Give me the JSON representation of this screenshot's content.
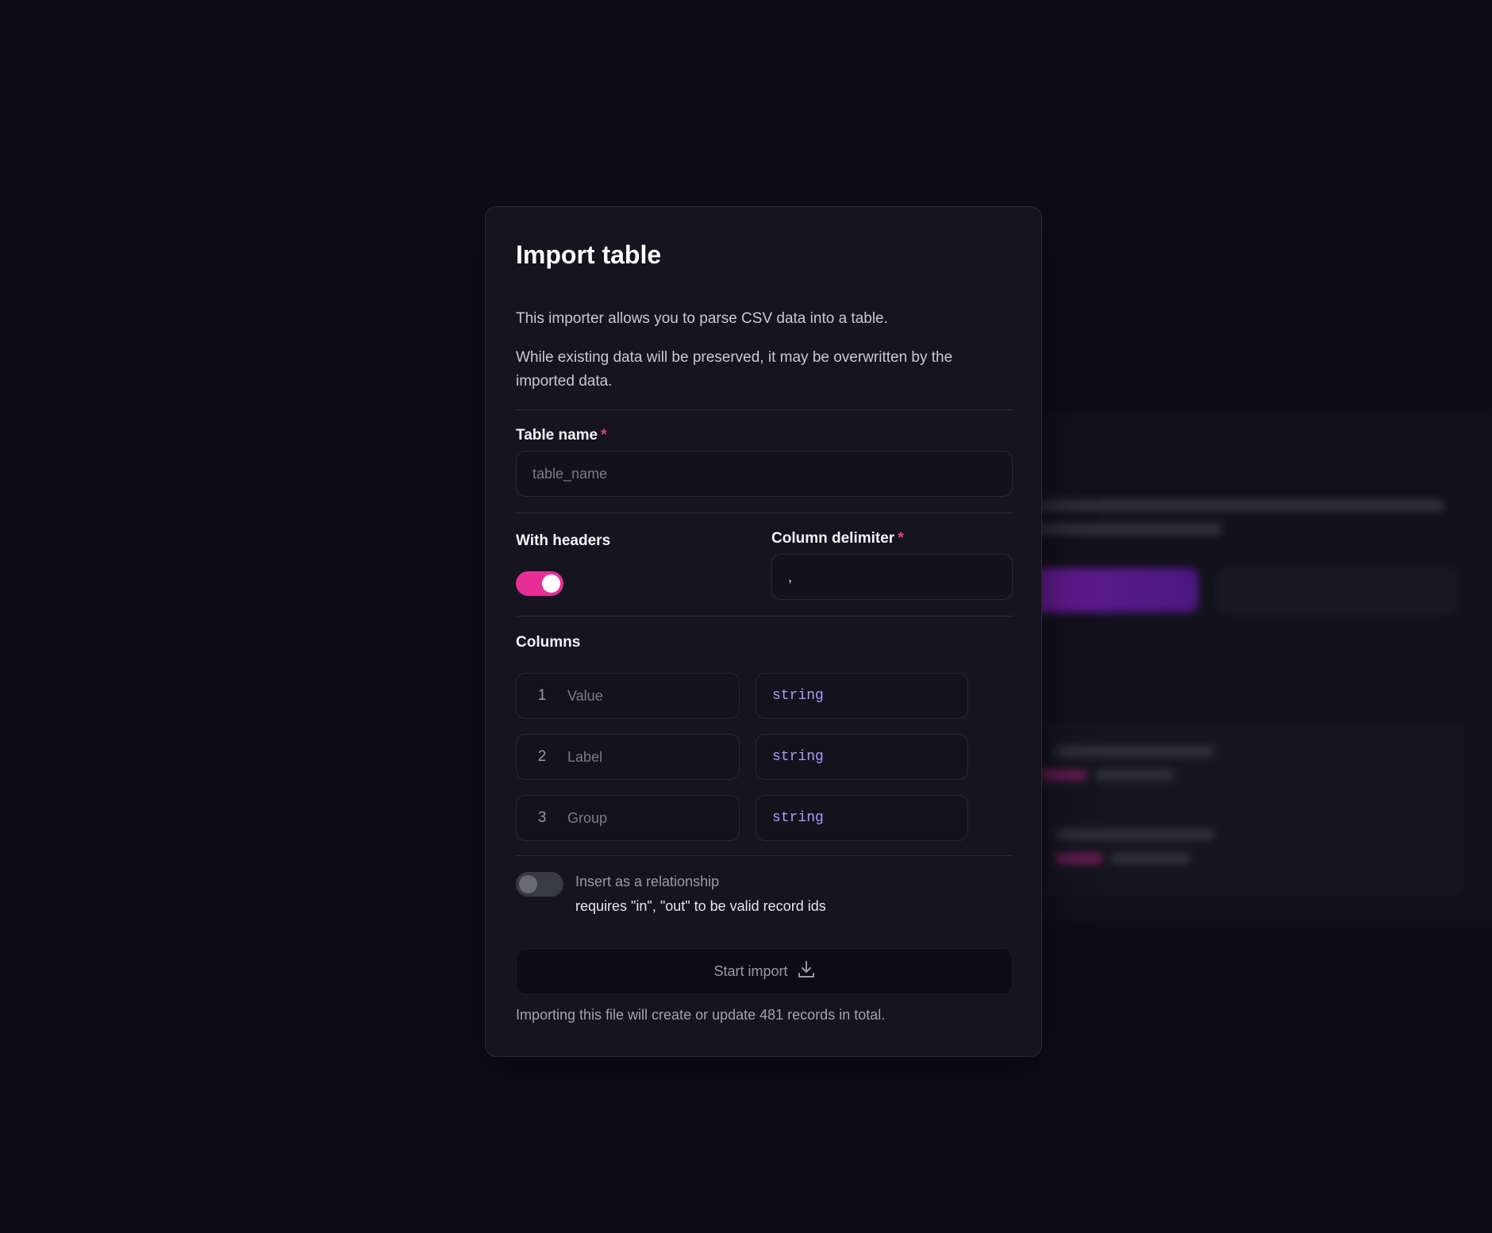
{
  "modal": {
    "title": "Import table",
    "description_1": "This importer allows you to parse CSV data into a table.",
    "description_2": "While existing data will be preserved, it may be overwritten by the imported data.",
    "table_name": {
      "label": "Table name",
      "required_mark": "*",
      "value": "",
      "placeholder": "table_name"
    },
    "with_headers": {
      "label": "With headers",
      "enabled": true
    },
    "column_delimiter": {
      "label": "Column delimiter",
      "required_mark": "*",
      "value": ","
    },
    "columns": {
      "label": "Columns",
      "items": [
        {
          "index": "1",
          "name": "Value",
          "type": "string"
        },
        {
          "index": "2",
          "name": "Label",
          "type": "string"
        },
        {
          "index": "3",
          "name": "Group",
          "type": "string"
        }
      ]
    },
    "relationship": {
      "label": "Insert as a relationship",
      "note": "requires \"in\", \"out\" to be valid record ids",
      "enabled": false
    },
    "start_button": {
      "label": "Start import",
      "icon": "download-icon"
    },
    "footer_text": "Importing this file will create or update 481 records in total."
  },
  "colors": {
    "accent_pink": "#e72f97",
    "type_purple": "#a99bff",
    "background": "#0f0e17",
    "modal_bg": "#16151f"
  }
}
